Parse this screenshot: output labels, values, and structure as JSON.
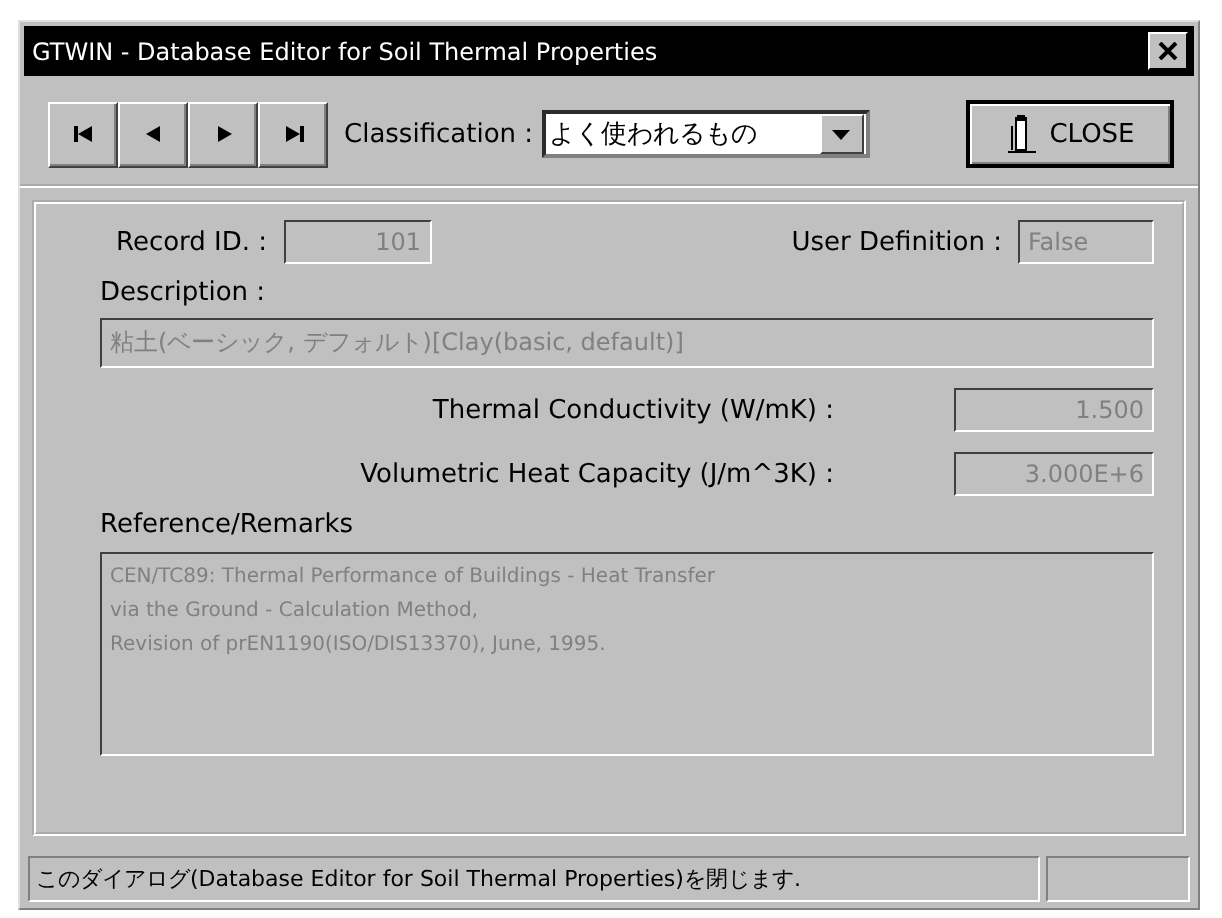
{
  "window": {
    "title": "GTWIN - Database Editor for Soil Thermal Properties"
  },
  "toolbar": {
    "nav_buttons": [
      {
        "kind": "first"
      },
      {
        "kind": "prev"
      },
      {
        "kind": "next"
      },
      {
        "kind": "last"
      }
    ],
    "classification_label": "Classification :",
    "classification_value": "よく使われるもの",
    "close_label": "CLOSE"
  },
  "form": {
    "record_id_label": "Record ID. :",
    "record_id": "101",
    "user_definition_label": "User Definition :",
    "user_definition": "False",
    "description_label": "Description :",
    "description": "粘土(ベーシック, デフォルト)[Clay(basic, default)]",
    "conductivity_label": "Thermal Conductivity (W/mK) :",
    "conductivity": "1.500",
    "heat_capacity_label": "Volumetric Heat Capacity (J/m^3K) :",
    "heat_capacity": "3.000E+6",
    "remarks_label": "Reference/Remarks",
    "remarks": [
      "CEN/TC89: Thermal Performance of Buildings - Heat Transfer",
      "via the Ground - Calculation Method,",
      "Revision of prEN1190(ISO/DIS13370), June, 1995."
    ]
  },
  "status_bar": {
    "message": "このダイアログ(Database Editor for Soil Thermal Properties)を閉じます."
  }
}
